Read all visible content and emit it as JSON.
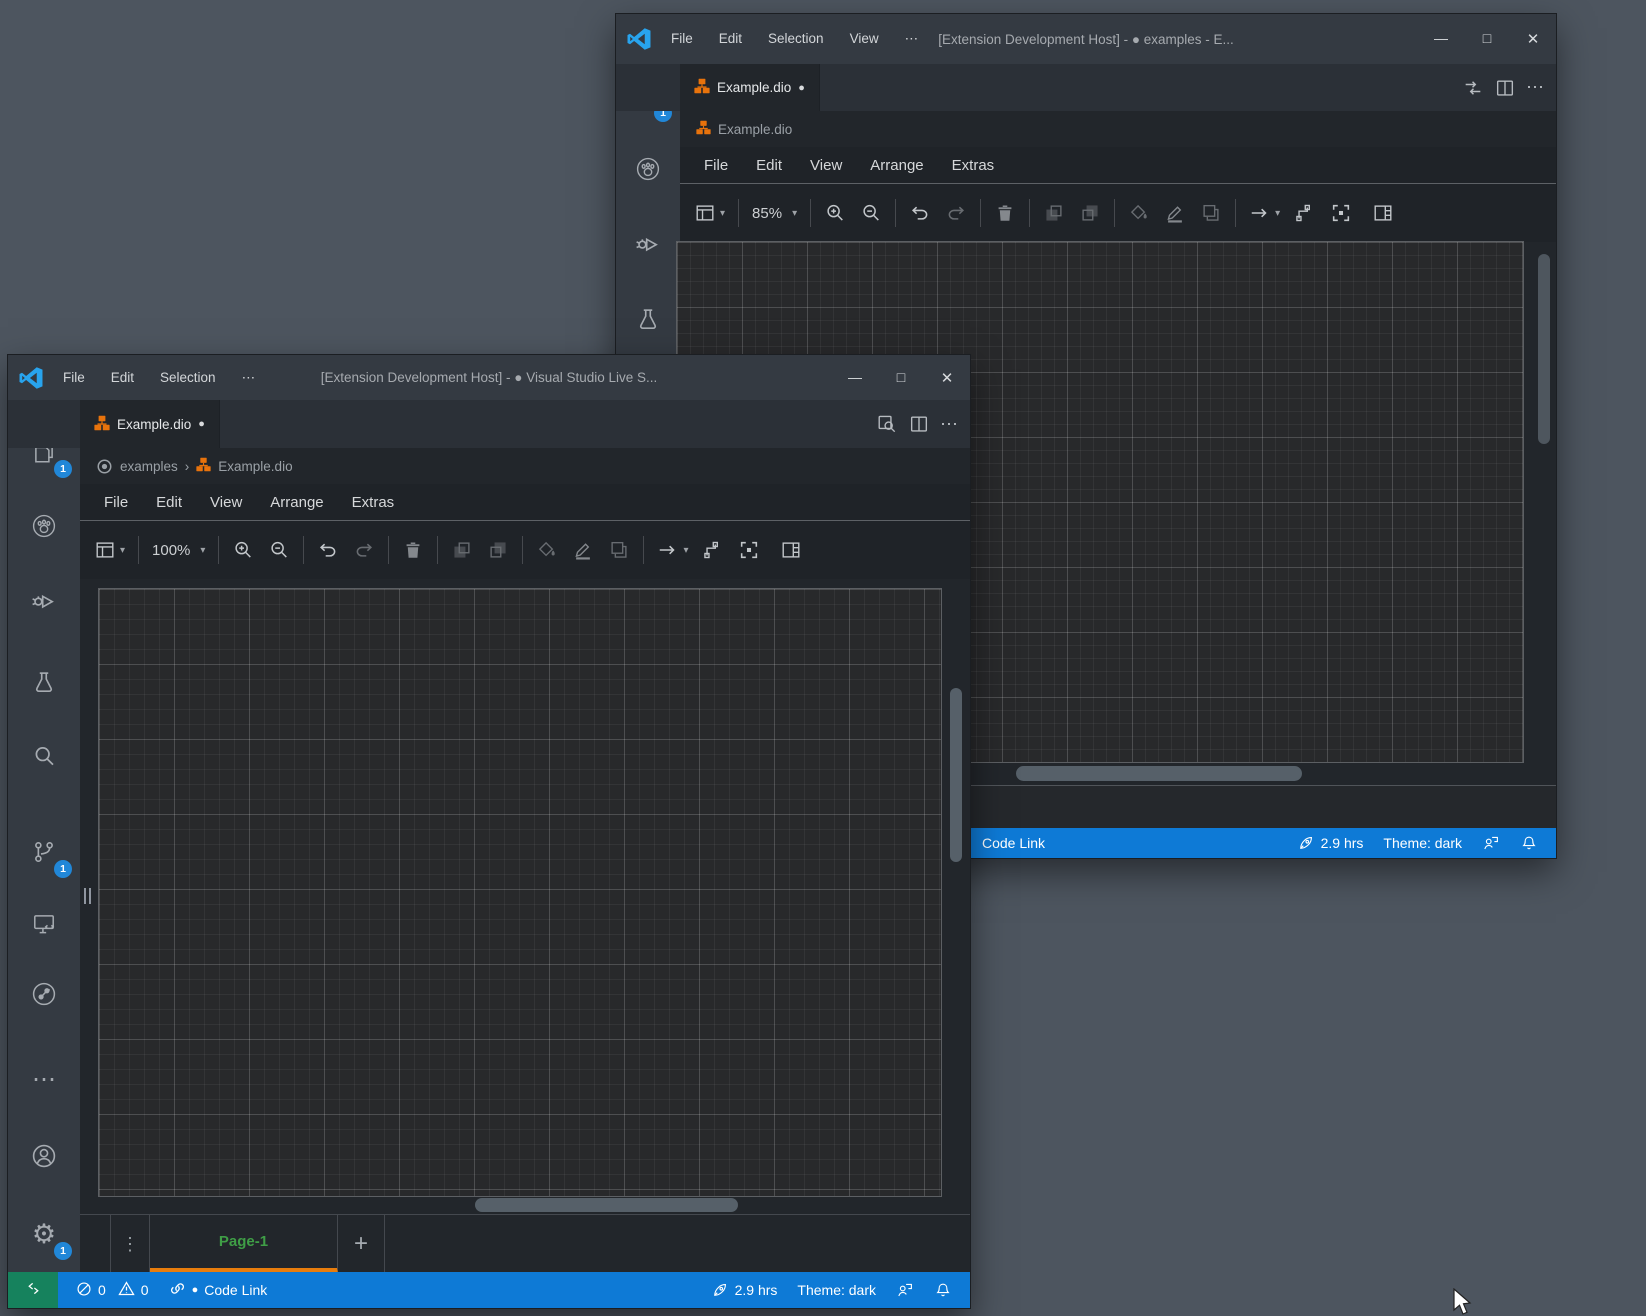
{
  "colors": {
    "desktop_gray": "#4d555f",
    "statusbar_blue": "#0e7ad6",
    "remote_green": "#16825d",
    "badge_blue": "#2187d8",
    "drawio_orange": "#e8730c",
    "page_tab_green": "#3f9e46",
    "page_underline_orange": "#e87d0d",
    "titlebar_dark": "#343a42"
  },
  "glyphs": {
    "more": "⋯",
    "kebab": "⋮",
    "dirty": "●",
    "minimize": "—",
    "maximize": "□",
    "close": "✕",
    "caret": "▾",
    "plus": "+",
    "crumb_sep": "›",
    "gear": "⚙"
  },
  "back_window": {
    "titlebar": {
      "menus": [
        "File",
        "Edit",
        "Selection",
        "View"
      ],
      "title": "[Extension Development Host] - ● examples - E..."
    },
    "tab": {
      "label": "Example.dio"
    },
    "breadcrumb": {
      "file": "Example.dio"
    },
    "drawio_menus": [
      "File",
      "Edit",
      "View",
      "Arrange",
      "Extras"
    ],
    "toolbar": {
      "zoom_level": "85%"
    },
    "activity_badges": {
      "explorer": "1"
    },
    "statusbar": {
      "code_link": "Code Link",
      "hours": "2.9 hrs",
      "theme": "Theme: dark"
    }
  },
  "front_window": {
    "titlebar": {
      "menus": [
        "File",
        "Edit",
        "Selection"
      ],
      "title": "[Extension Development Host] - ● Visual Studio Live S..."
    },
    "tab": {
      "label": "Example.dio"
    },
    "breadcrumb": {
      "folder": "examples",
      "file": "Example.dio"
    },
    "drawio_menus": [
      "File",
      "Edit",
      "View",
      "Arrange",
      "Extras"
    ],
    "toolbar": {
      "zoom_level": "100%"
    },
    "activity_badges": {
      "explorer": "1",
      "source_control": "1",
      "settings": "1"
    },
    "page_tabs": {
      "page": "Page-1"
    },
    "statusbar": {
      "errors": "0",
      "warnings": "0",
      "code_link": "Code Link",
      "hours": "2.9 hrs",
      "theme": "Theme: dark"
    }
  }
}
